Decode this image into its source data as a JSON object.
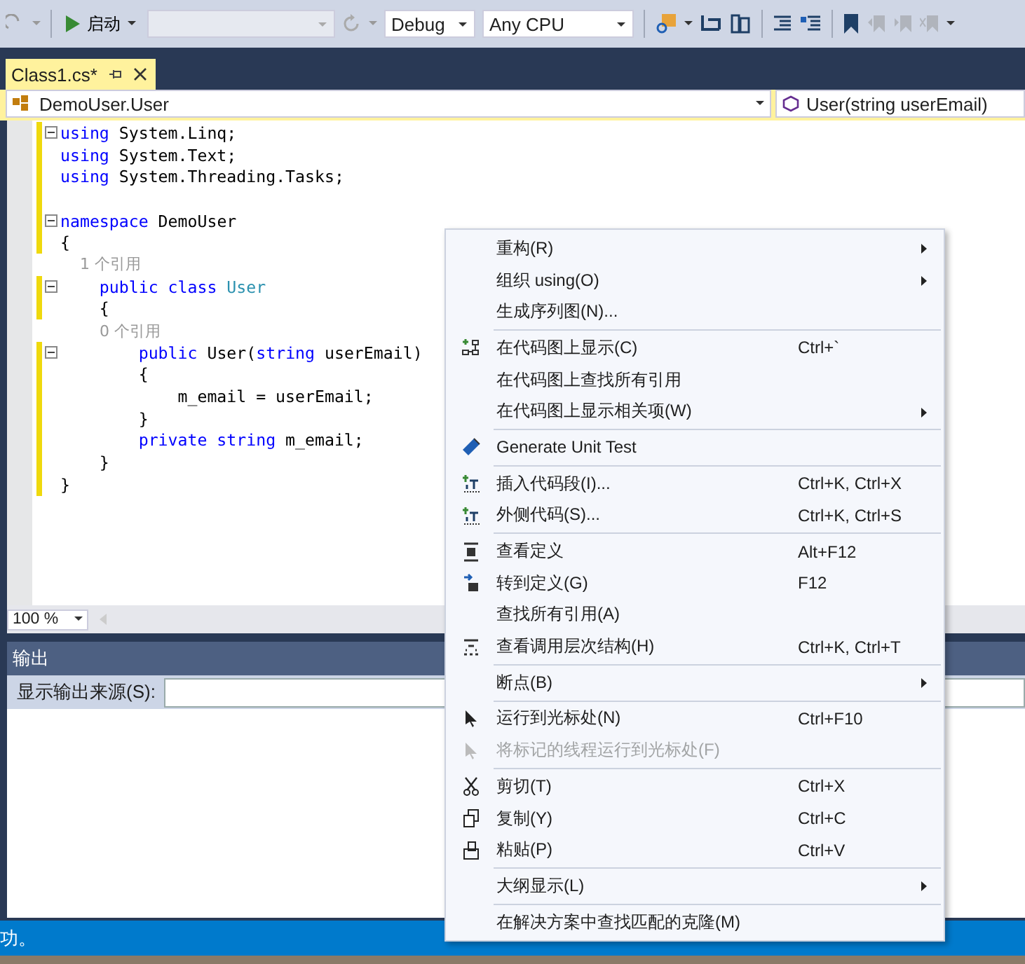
{
  "toolbar": {
    "start_label": "启动",
    "configuration": "Debug",
    "platform": "Any CPU"
  },
  "document_tabs": [
    {
      "label": "Class1.cs*",
      "selected": true
    }
  ],
  "navigation": {
    "type_combo": "DemoUser.User",
    "member_combo": "User(string userEmail)"
  },
  "editor": {
    "lines": [
      {
        "fold": true,
        "changed": true,
        "tokens": [
          {
            "kind": "keyword",
            "text": "using"
          },
          {
            "kind": "plain",
            "text": " System.Linq;"
          }
        ]
      },
      {
        "fold": false,
        "changed": true,
        "tokens": [
          {
            "kind": "keyword",
            "text": "using"
          },
          {
            "kind": "plain",
            "text": " System.Text;"
          }
        ]
      },
      {
        "fold": false,
        "changed": true,
        "tokens": [
          {
            "kind": "keyword",
            "text": "using"
          },
          {
            "kind": "plain",
            "text": " System.Threading.Tasks;"
          }
        ]
      },
      {
        "fold": false,
        "changed": true
      },
      {
        "fold": true,
        "changed": true,
        "tokens": [
          {
            "kind": "keyword",
            "text": "namespace"
          },
          {
            "kind": "plain",
            "text": " DemoUser"
          }
        ]
      },
      {
        "fold": false,
        "changed": true,
        "tokens": [
          {
            "kind": "plain",
            "text": "{"
          }
        ]
      },
      {
        "fold": false,
        "changed": false,
        "tokens": [
          {
            "kind": "lens",
            "text": "    1 个引用"
          }
        ]
      },
      {
        "fold": true,
        "changed": true,
        "tokens": [
          {
            "kind": "keyword",
            "text": "    public class"
          },
          {
            "kind": "type",
            "text": " User"
          }
        ]
      },
      {
        "fold": false,
        "changed": true,
        "tokens": [
          {
            "kind": "plain",
            "text": "    {"
          }
        ]
      },
      {
        "fold": false,
        "changed": false,
        "tokens": [
          {
            "kind": "lens",
            "text": "        0 个引用"
          }
        ]
      },
      {
        "fold": true,
        "changed": true,
        "tokens": [
          {
            "kind": "keyword",
            "text": "        public"
          },
          {
            "kind": "plain",
            "text": " User("
          },
          {
            "kind": "keyword",
            "text": "string"
          },
          {
            "kind": "plain",
            "text": " userEmail)"
          }
        ]
      },
      {
        "fold": false,
        "changed": true,
        "tokens": [
          {
            "kind": "plain",
            "text": "        {"
          }
        ]
      },
      {
        "fold": false,
        "changed": true,
        "tokens": [
          {
            "kind": "plain",
            "text": "            m_email = userEmail;"
          }
        ]
      },
      {
        "fold": false,
        "changed": true,
        "tokens": [
          {
            "kind": "plain",
            "text": "        }"
          }
        ]
      },
      {
        "fold": false,
        "changed": true,
        "tokens": [
          {
            "kind": "keyword",
            "text": "        private string"
          },
          {
            "kind": "plain",
            "text": " m_email;"
          }
        ]
      },
      {
        "fold": false,
        "changed": true,
        "tokens": [
          {
            "kind": "plain",
            "text": "    }"
          }
        ]
      },
      {
        "fold": false,
        "changed": true,
        "tokens": [
          {
            "kind": "plain",
            "text": "}"
          }
        ]
      }
    ],
    "zoom": "100 %"
  },
  "output_panel": {
    "title": "输出",
    "source_label": "显示输出来源(S):"
  },
  "status_bar": {
    "text": "功。"
  },
  "context_menu": {
    "groups": [
      [
        {
          "label": "重构(R)",
          "submenu": true,
          "disabled": false
        },
        {
          "label": "组织 using(O)",
          "submenu": true,
          "disabled": false
        },
        {
          "label": "生成序列图(N)...",
          "submenu": false,
          "disabled": false
        }
      ],
      [
        {
          "label": "在代码图上显示(C)",
          "shortcut": "Ctrl+`",
          "submenu": false,
          "disabled": false
        },
        {
          "label": "在代码图上查找所有引用",
          "submenu": false,
          "disabled": false
        },
        {
          "label": "在代码图上显示相关项(W)",
          "submenu": true,
          "disabled": false
        }
      ],
      [
        {
          "label": "Generate Unit Test",
          "submenu": false,
          "disabled": false
        }
      ],
      [
        {
          "label": "插入代码段(I)...",
          "shortcut": "Ctrl+K, Ctrl+X",
          "submenu": false,
          "disabled": false
        },
        {
          "label": "外侧代码(S)...",
          "shortcut": "Ctrl+K, Ctrl+S",
          "submenu": false,
          "disabled": false
        }
      ],
      [
        {
          "label": "查看定义",
          "shortcut": "Alt+F12",
          "submenu": false,
          "disabled": false
        },
        {
          "label": "转到定义(G)",
          "shortcut": "F12",
          "submenu": false,
          "disabled": false
        },
        {
          "label": "查找所有引用(A)",
          "submenu": false,
          "disabled": false
        },
        {
          "label": "查看调用层次结构(H)",
          "shortcut": "Ctrl+K, Ctrl+T",
          "submenu": false,
          "disabled": false
        }
      ],
      [
        {
          "label": "断点(B)",
          "submenu": true,
          "disabled": false
        }
      ],
      [
        {
          "label": "运行到光标处(N)",
          "shortcut": "Ctrl+F10",
          "submenu": false,
          "disabled": false
        },
        {
          "label": "将标记的线程运行到光标处(F)",
          "submenu": false,
          "disabled": true
        }
      ],
      [
        {
          "label": "剪切(T)",
          "shortcut": "Ctrl+X",
          "submenu": false,
          "disabled": false
        },
        {
          "label": "复制(Y)",
          "shortcut": "Ctrl+C",
          "submenu": false,
          "disabled": false
        },
        {
          "label": "粘贴(P)",
          "shortcut": "Ctrl+V",
          "submenu": false,
          "disabled": false
        }
      ],
      [
        {
          "label": "大纲显示(L)",
          "submenu": true,
          "disabled": false
        }
      ],
      [
        {
          "label": "在解决方案中查找匹配的克隆(M)",
          "submenu": false,
          "disabled": false
        }
      ]
    ]
  }
}
